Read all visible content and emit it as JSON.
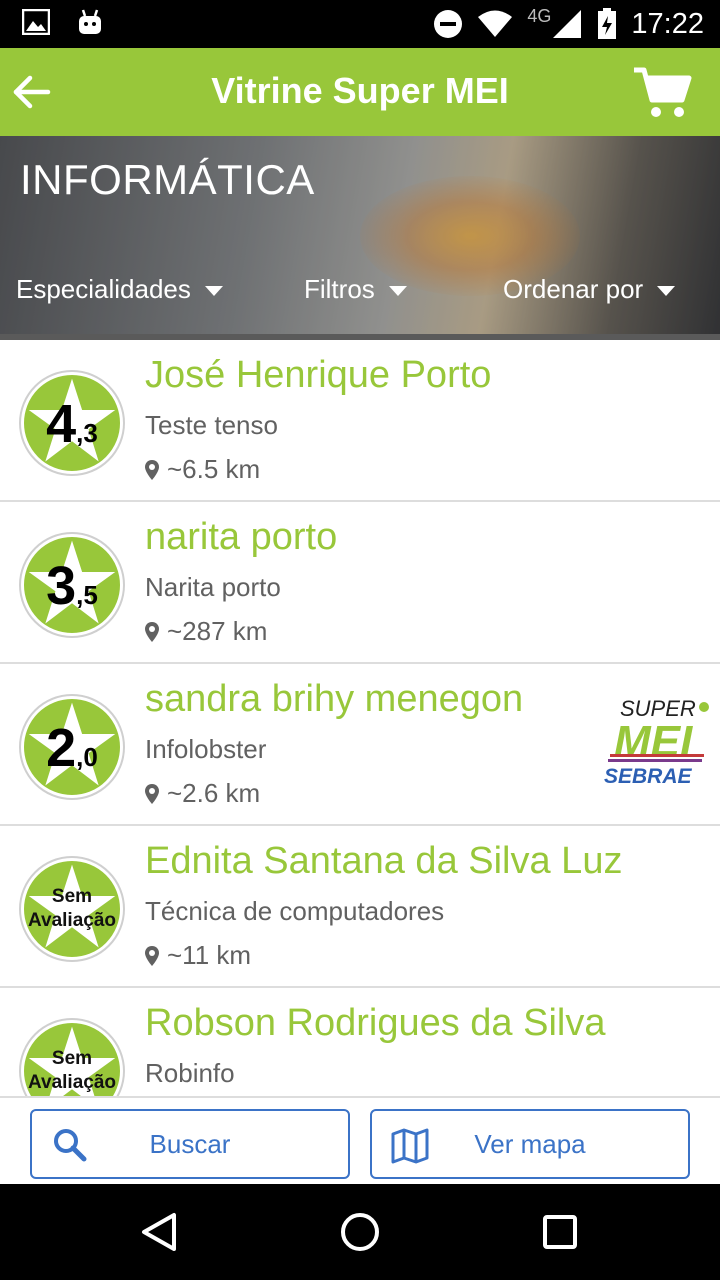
{
  "status_bar": {
    "network": "4G",
    "time": "17:22"
  },
  "app_bar": {
    "title": "Vitrine Super MEI"
  },
  "hero": {
    "category": "INFORMÁTICA",
    "filters": [
      {
        "label": "Especialidades"
      },
      {
        "label": "Filtros"
      },
      {
        "label": "Ordenar por"
      }
    ]
  },
  "listings": [
    {
      "name": "José Henrique Porto",
      "subtitle": "Teste tenso",
      "distance": "~6.5 km",
      "rating_int": "4",
      "rating_dec": ",3",
      "no_rating": null,
      "super_mei": false
    },
    {
      "name": "narita porto",
      "subtitle": "Narita porto",
      "distance": "~287 km",
      "rating_int": "3",
      "rating_dec": ",5",
      "no_rating": null,
      "super_mei": false
    },
    {
      "name": "sandra brihy menegon",
      "subtitle": "Infolobster",
      "distance": "~2.6 km",
      "rating_int": "2",
      "rating_dec": ",0",
      "no_rating": null,
      "super_mei": true
    },
    {
      "name": "Ednita Santana da Silva Luz",
      "subtitle": "Técnica de computadores",
      "distance": "~11 km",
      "rating_int": null,
      "rating_dec": null,
      "no_rating": [
        "Sem",
        "Avaliação"
      ],
      "super_mei": false
    },
    {
      "name": "Robson Rodrigues da Silva",
      "subtitle": "Robinfo",
      "distance": "",
      "rating_int": null,
      "rating_dec": null,
      "no_rating": [
        "Sem",
        "Avaliação"
      ],
      "super_mei": false
    }
  ],
  "super_mei_logo": {
    "line1": "SUPER",
    "line2": "MEI",
    "line3": "SEBRAE"
  },
  "bottom_actions": {
    "search_label": "Buscar",
    "map_label": "Ver mapa"
  },
  "colors": {
    "brand_green": "#98c73a",
    "action_blue": "#3b73c7",
    "text_gray": "#616161"
  }
}
